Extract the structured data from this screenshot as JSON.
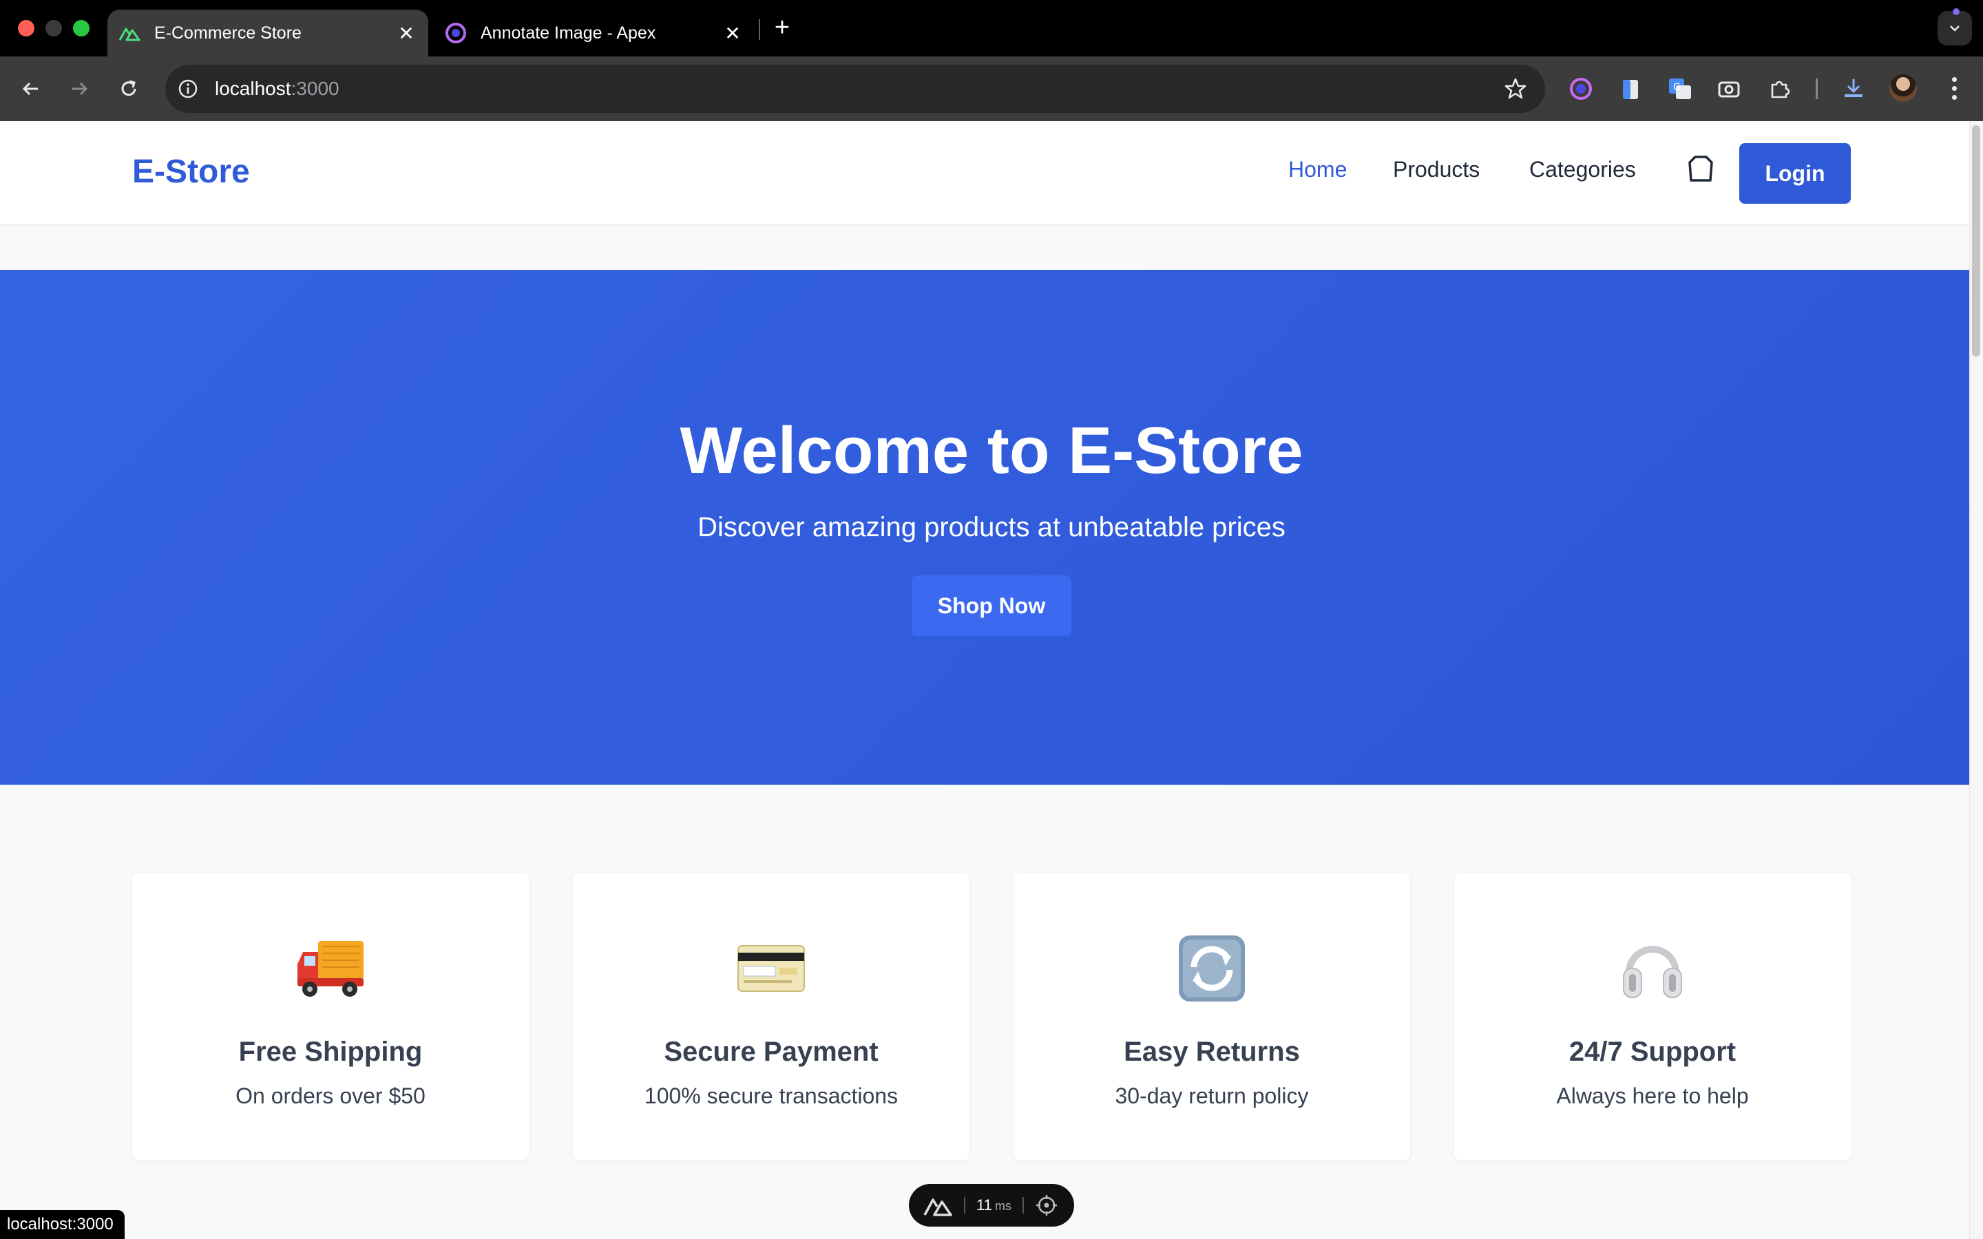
{
  "browser": {
    "tabs": [
      {
        "title": "E-Commerce Store",
        "active": true,
        "favicon": "nuxt-icon"
      },
      {
        "title": "Annotate Image - Apex",
        "active": false,
        "favicon": "apex-icon"
      }
    ],
    "close_glyph": "✕",
    "new_tab_glyph": "+",
    "url_host": "localhost",
    "url_port": ":3000",
    "status_url": "localhost:3000",
    "colors": {
      "frame": "#000000",
      "toolbar": "#3c3c3c",
      "omnibox": "#282828"
    }
  },
  "site": {
    "logo": "E-Store",
    "nav": [
      {
        "label": "Home",
        "active": true
      },
      {
        "label": "Products",
        "active": false
      },
      {
        "label": "Categories",
        "active": false
      }
    ],
    "cart_icon": "shopping-bag-icon",
    "login_label": "Login",
    "colors": {
      "brand": "#2f5ad8",
      "hero": "#3563e3",
      "text": "#374151"
    }
  },
  "hero": {
    "title": "Welcome to E-Store",
    "subtitle": "Discover amazing products at unbeatable prices",
    "cta": "Shop Now"
  },
  "features": [
    {
      "icon": "delivery-truck-icon",
      "title": "Free Shipping",
      "description": "On orders over $50"
    },
    {
      "icon": "credit-card-icon",
      "title": "Secure Payment",
      "description": "100% secure transactions"
    },
    {
      "icon": "refresh-arrows-icon",
      "title": "Easy Returns",
      "description": "30-day return policy"
    },
    {
      "icon": "headphones-icon",
      "title": "24/7 Support",
      "description": "Always here to help"
    }
  ],
  "devtools": {
    "render_time": "11",
    "unit": "ms"
  }
}
